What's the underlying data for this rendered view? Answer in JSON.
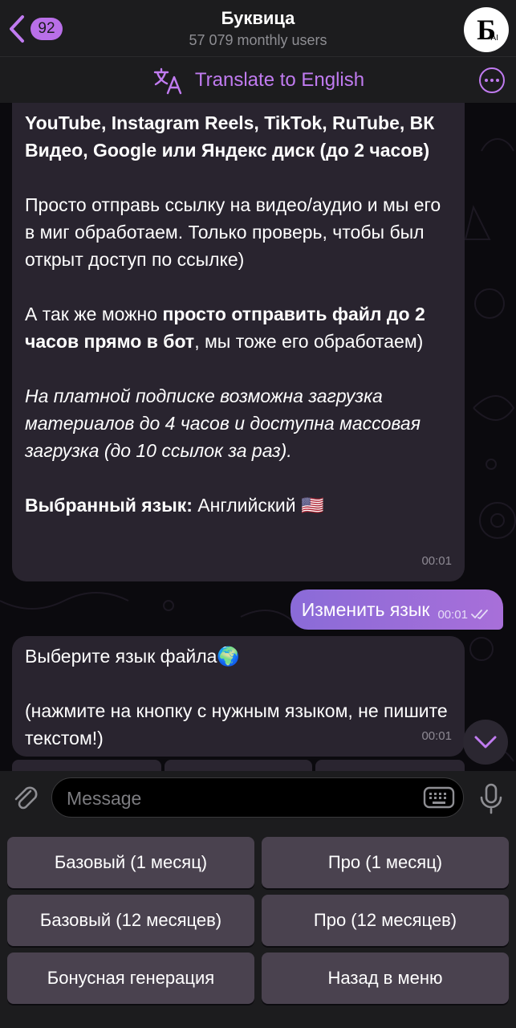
{
  "header": {
    "back_badge": "92",
    "title": "Буквица",
    "subtitle": "57 079 monthly users",
    "avatar_letter": "Б",
    "avatar_sup": "AI"
  },
  "translate_bar": {
    "label": "Translate to English",
    "icon": "translate-icon",
    "more_icon": "more-icon"
  },
  "messages": {
    "incoming_1": {
      "line1": "YouTube, Instagram Reels, TikTok, RuTube, ВК Видео, Google или Яндекс диск (до 2 часов)",
      "para2": "Просто отправь ссылку на видео/аудио и мы его в миг обработаем. Только проверь, чтобы был открыт доступ по ссылке)",
      "para3_start": "А так же можно ",
      "para3_bold": "просто отправить файл до 2 часов прямо в бот",
      "para3_end": ", мы тоже его обработаем)",
      "para4": "На платной подписке возможна загрузка материалов до 4 часов и доступна массовая загрузка (до 10 ссылок за раз).",
      "lang_label": "Выбранный язык:",
      "lang_value": " Английский 🇺🇸",
      "time": "00:01"
    },
    "outgoing": {
      "text": "Изменить язык",
      "time": "00:01"
    },
    "incoming_2": {
      "line1": "Выберите язык файла🌍",
      "line2": "(нажмите на кнопку с нужным языком, не пишите текстом!)",
      "time": "00:01"
    }
  },
  "composer": {
    "placeholder": "Message"
  },
  "keyboard": {
    "buttons": [
      "Базовый (1 месяц)",
      "Про (1 месяц)",
      "Базовый (12 месяцев)",
      "Про (12 месяцев)",
      "Бонусная генерация",
      "Назад в меню"
    ]
  },
  "colors": {
    "accent": "#c07bf0",
    "bubble_in": "#29242f",
    "bubble_out": "#9a6dd8",
    "kb_button": "#4a424f"
  }
}
